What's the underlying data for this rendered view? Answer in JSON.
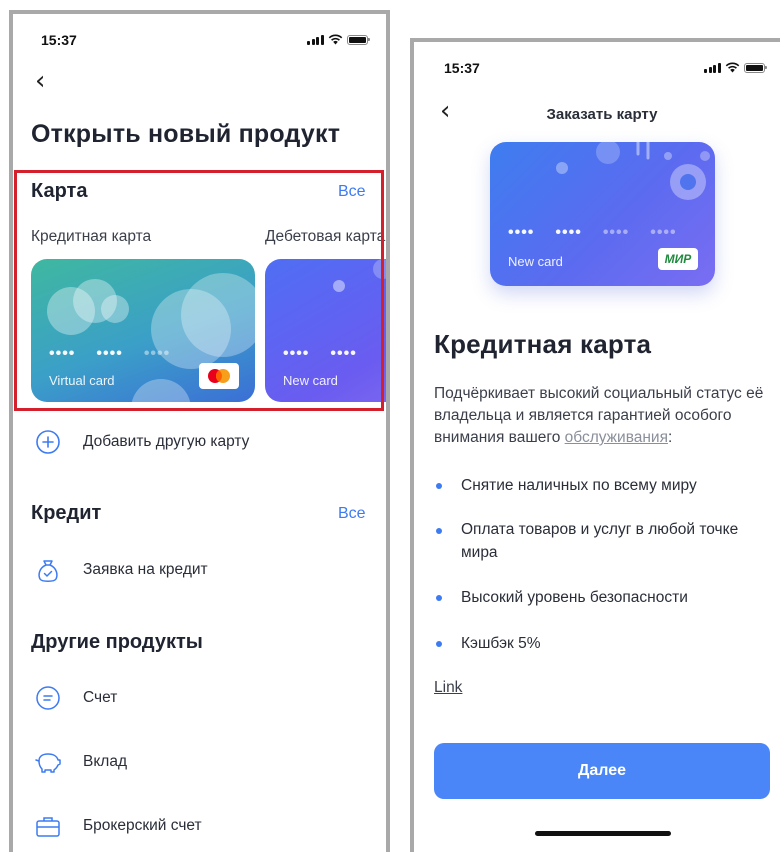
{
  "left": {
    "status": {
      "time": "15:37"
    },
    "title": "Открыть новый продукт",
    "card_section": {
      "title": "Карта",
      "all_link": "Все",
      "credit_label": "Кредитная карта",
      "debit_label": "Дебетовая карта",
      "credit_card": {
        "number": [
          "••••",
          "••••",
          "••••"
        ],
        "name": "Virtual card",
        "brand": "mastercard-logo"
      },
      "debit_card": {
        "number": [
          "••••",
          "••••"
        ],
        "name": "New card"
      }
    },
    "add_card": "Добавить другую карту",
    "credit_section": {
      "title": "Кредит",
      "all_link": "Все",
      "apply": "Заявка на кредит"
    },
    "other_section": {
      "title": "Другие продукты",
      "items": [
        "Счет",
        "Вклад",
        "Брокерский счет"
      ]
    }
  },
  "right": {
    "status": {
      "time": "15:37"
    },
    "header_title": "Заказать карту",
    "card": {
      "number": [
        "••••",
        "••••",
        "••••",
        "••••"
      ],
      "name": "New card",
      "brand": "МИР"
    },
    "title": "Кредитная карта",
    "description_prefix": "Подчёркивает высокий социальный статус её владельца и является гарантией особого внимания вашего ",
    "description_link": "обслуживания",
    "description_suffix": ":",
    "bullets": [
      "Снятие наличных по всему миру",
      "Оплата товаров и услуг в любой точке мира",
      "Высокий уровень безопасности",
      "Кэшбэк 5%"
    ],
    "link": "Link",
    "next_button": "Далее"
  },
  "colors": {
    "accent": "#3d7bf2",
    "button": "#4a86f7",
    "highlight": "#d3202c"
  }
}
